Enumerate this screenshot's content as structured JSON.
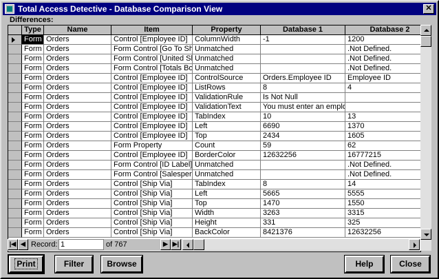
{
  "window": {
    "title": "Total Access Detective - Database Comparison View",
    "close_glyph": "✕"
  },
  "section_label": "Differences:",
  "grid": {
    "columns": [
      "Type",
      "Name",
      "Item",
      "Property",
      "Database 1",
      "Database 2"
    ],
    "rows": [
      [
        "Form",
        "Orders",
        "Control [Employee ID]",
        "ColumnWidth",
        "-1",
        "1200"
      ],
      [
        "Form",
        "Orders",
        "Form Control [Go To Ship",
        "Unmatched",
        "",
        ".Not Defined."
      ],
      [
        "Form",
        "Orders",
        "Form Control [United Shi",
        "Unmatched",
        "",
        ".Not Defined."
      ],
      [
        "Form",
        "Orders",
        "Form Control [Totals Box",
        "Unmatched",
        "",
        ".Not Defined."
      ],
      [
        "Form",
        "Orders",
        "Control [Employee ID]",
        "ControlSource",
        "Orders.Employee ID",
        "Employee ID"
      ],
      [
        "Form",
        "Orders",
        "Control [Employee ID]",
        "ListRows",
        "8",
        "4"
      ],
      [
        "Form",
        "Orders",
        "Control [Employee ID]",
        "ValidationRule",
        " Is Not Null",
        ""
      ],
      [
        "Form",
        "Orders",
        "Control [Employee ID]",
        "ValidationText",
        "You must enter an emplo",
        ""
      ],
      [
        "Form",
        "Orders",
        "Control [Employee ID]",
        "TabIndex",
        "10",
        "13"
      ],
      [
        "Form",
        "Orders",
        "Control [Employee ID]",
        "Left",
        "6690",
        "1370"
      ],
      [
        "Form",
        "Orders",
        "Control [Employee ID]",
        "Top",
        "2434",
        "1605"
      ],
      [
        "Form",
        "Orders",
        "Form Property",
        "Count",
        "59",
        "62"
      ],
      [
        "Form",
        "Orders",
        "Control [Employee ID]",
        "BorderColor",
        "12632256",
        "16777215"
      ],
      [
        "Form",
        "Orders",
        "Form Control [ID Label]",
        "Unmatched",
        "",
        ".Not Defined."
      ],
      [
        "Form",
        "Orders",
        "Form Control [Salespers",
        "Unmatched",
        "",
        ".Not Defined."
      ],
      [
        "Form",
        "Orders",
        "Control [Ship Via]",
        "TabIndex",
        "8",
        "14"
      ],
      [
        "Form",
        "Orders",
        "Control [Ship Via]",
        "Left",
        "5665",
        "5555"
      ],
      [
        "Form",
        "Orders",
        "Control [Ship Via]",
        "Top",
        "1470",
        "1550"
      ],
      [
        "Form",
        "Orders",
        "Control [Ship Via]",
        "Width",
        "3263",
        "3315"
      ],
      [
        "Form",
        "Orders",
        "Control [Ship Via]",
        "Height",
        "331",
        "325"
      ],
      [
        "Form",
        "Orders",
        "Control [Ship Via]",
        "BackColor",
        "8421376",
        "12632256"
      ]
    ]
  },
  "record_nav": {
    "label": "Record:",
    "current": "1",
    "of_text": "of  767",
    "first_glyph": "|◀",
    "prev_glyph": "◀",
    "next_glyph": "▶",
    "last_glyph": "▶|"
  },
  "buttons": {
    "print": "Print",
    "filter": "Filter",
    "browse": "Browse",
    "help": "Help",
    "close": "Close"
  }
}
